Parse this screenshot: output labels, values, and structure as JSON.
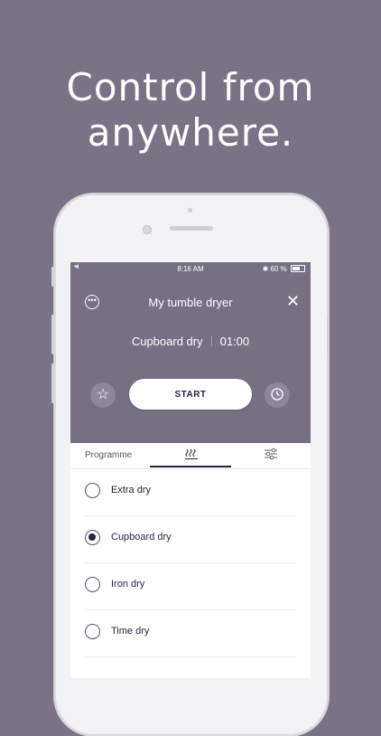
{
  "headline": [
    "Control from",
    "anywhere."
  ],
  "status_bar": {
    "signal": "••ıl",
    "time": "8:16 AM",
    "bluetooth": "✱",
    "battery": "60 %"
  },
  "header": {
    "title": "My tumble dryer",
    "program": "Cupboard dry",
    "duration": "01:00",
    "start_label": "START",
    "menu_icon": "more-icon",
    "close_icon": "close-icon"
  },
  "tabs": {
    "programme": "Programme",
    "heat_icon": "heat-icon",
    "settings_icon": "sliders-icon"
  },
  "options": [
    {
      "label": "Extra dry",
      "selected": false
    },
    {
      "label": "Cupboard dry",
      "selected": true
    },
    {
      "label": "Iron dry",
      "selected": false
    },
    {
      "label": "Time dry",
      "selected": false
    }
  ],
  "colors": {
    "background": "#7a7385",
    "header": "#776f82",
    "accent": "#26253a"
  }
}
